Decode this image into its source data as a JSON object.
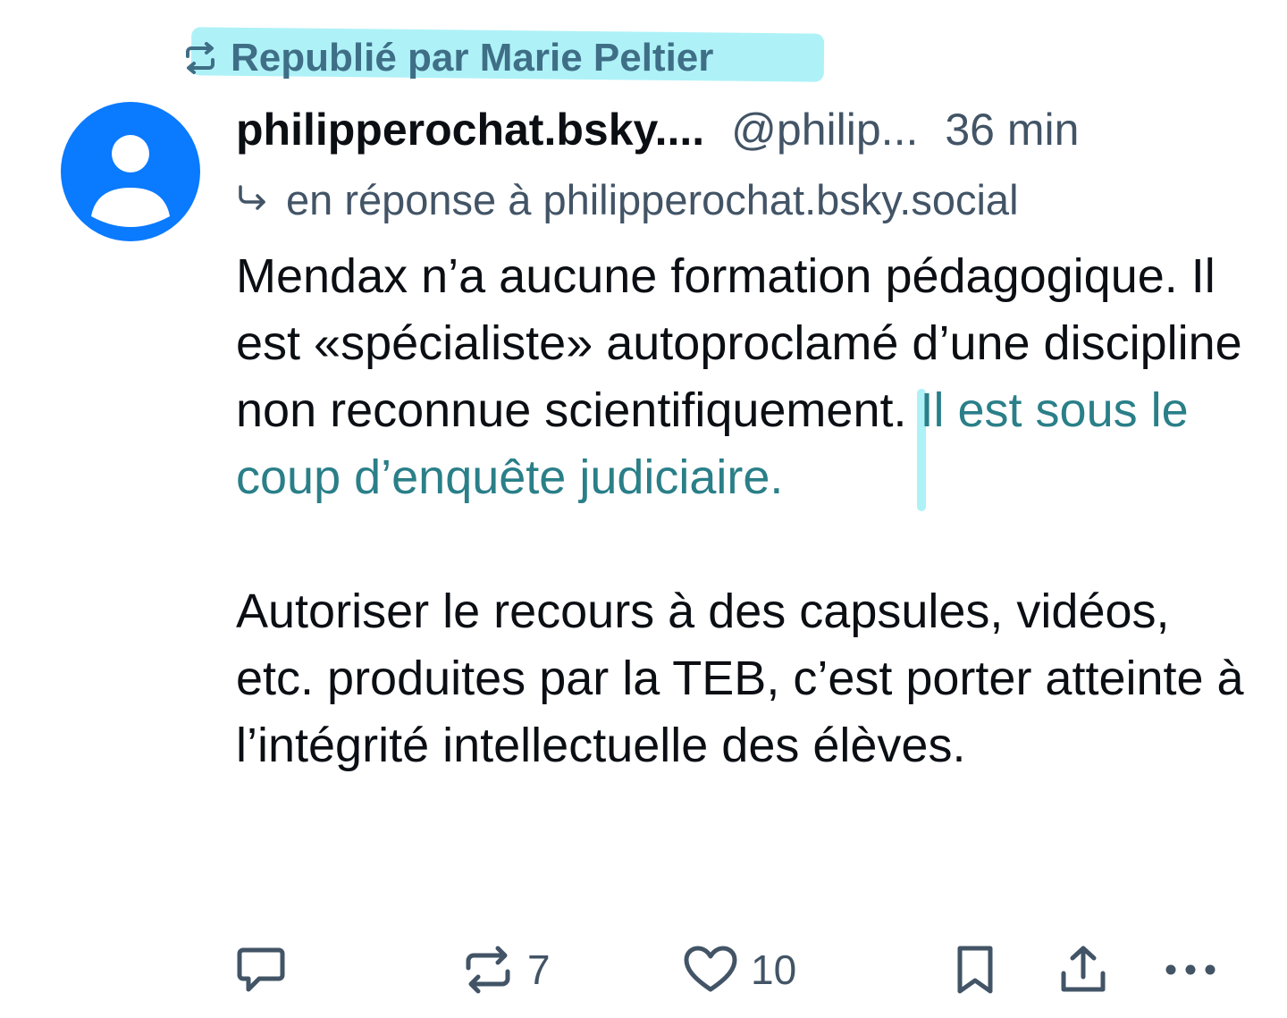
{
  "repost": {
    "label": "Republié par Marie Peltier",
    "icon": "repost-icon"
  },
  "author": {
    "display_name": "philipperochat.bsky....",
    "handle": "@philip...",
    "time": "36 min",
    "avatar_icon": "default-user-avatar"
  },
  "reply": {
    "icon": "reply-arrow-icon",
    "label": "en réponse à philipperochat.bsky.social"
  },
  "body": {
    "p1_plain": "Mendax n’a aucune formation pédagogique. Il est «spécialiste» autoproclamé d’une discipline non reconnue scientifiquement. ",
    "p1_highlight": "Il est sous le coup d’enquête judiciaire.",
    "p2": "Autoriser le recours à des capsules, vidéos, etc. produites par la TEB, c’est porter atteinte à l’intégrité intellectuelle des élèves."
  },
  "actions": {
    "reply_icon": "comment-icon",
    "repost_icon": "repost-icon",
    "repost_count": "7",
    "like_icon": "heart-icon",
    "like_count": "10",
    "bookmark_icon": "bookmark-icon",
    "share_icon": "share-icon",
    "more_icon": "more-dots-icon"
  },
  "colors": {
    "avatar": "#0a7aff",
    "highlight": "#aef2f8",
    "muted_text": "#425466",
    "highlight_text": "#2a7f88"
  }
}
